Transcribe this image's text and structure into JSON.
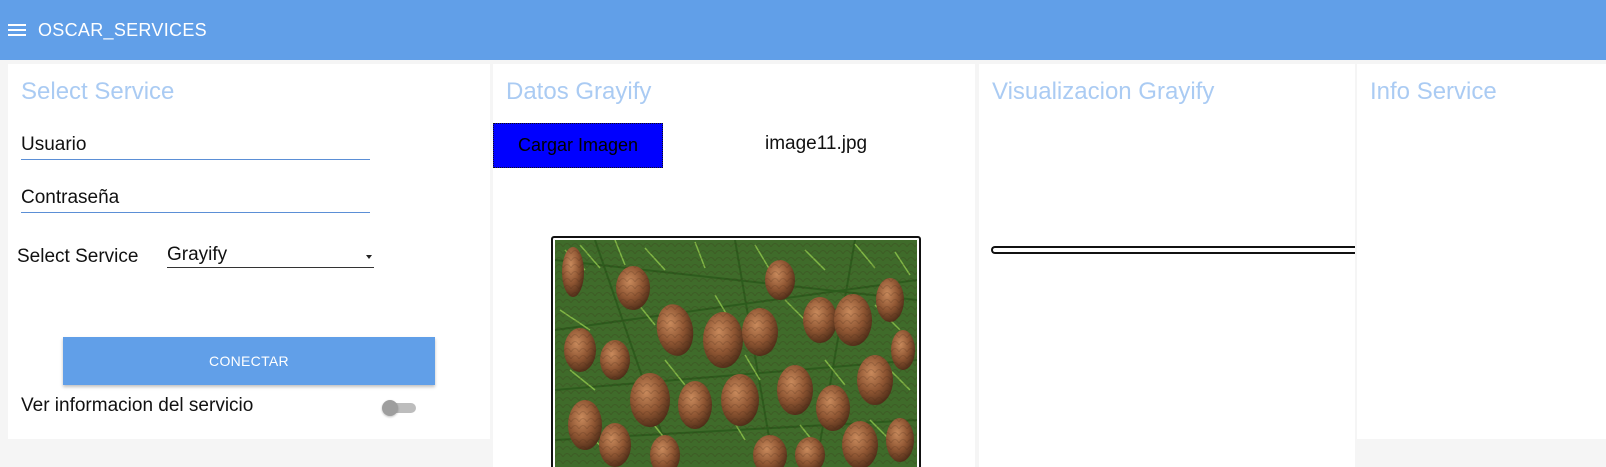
{
  "app": {
    "title": "OSCAR_SERVICES"
  },
  "select_panel": {
    "title": "Select Service",
    "user_placeholder": "Usuario",
    "pass_placeholder": "Contraseña",
    "service_label": "Select Service",
    "service_value": "Grayify",
    "connect_label": "CONECTAR",
    "info_label": "Ver informacion del servicio",
    "info_toggle_on": false
  },
  "data_panel": {
    "title": "Datos Grayify",
    "load_label": "Cargar Imagen",
    "filename": "image11.jpg",
    "image_subject": "pine-cones-on-spruce-branches"
  },
  "vis_panel": {
    "title": "Visualizacion Grayify"
  },
  "info_panel": {
    "title": "Info Service"
  },
  "colors": {
    "header": "#619fe8",
    "title_text": "#aacbf3",
    "load_button": "#0000ff"
  }
}
